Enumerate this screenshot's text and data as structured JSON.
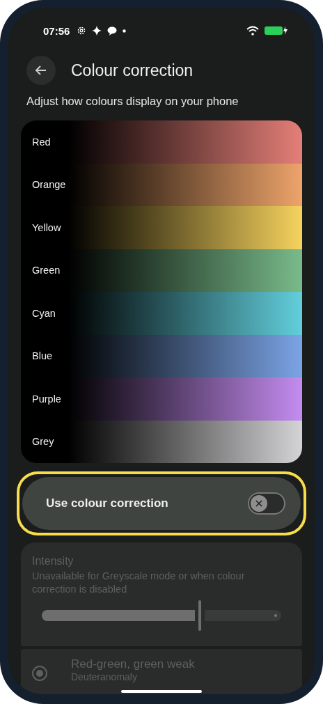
{
  "status_bar": {
    "time": "07:56",
    "charging": true
  },
  "header": {
    "title": "Colour correction"
  },
  "subtitle": "Adjust how colours display on your phone",
  "colour_bars": [
    {
      "label": "Red",
      "color": "#e57f78"
    },
    {
      "label": "Orange",
      "color": "#eea46b"
    },
    {
      "label": "Yellow",
      "color": "#f6d35e"
    },
    {
      "label": "Green",
      "color": "#79bb8a"
    },
    {
      "label": "Cyan",
      "color": "#62cfdc"
    },
    {
      "label": "Blue",
      "color": "#7ba4e6"
    },
    {
      "label": "Purple",
      "color": "#c48cf0"
    },
    {
      "label": "Grey",
      "color": "#d4d4d6"
    }
  ],
  "main_toggle": {
    "label": "Use colour correction",
    "on": false,
    "highlighted": true
  },
  "intensity": {
    "title": "Intensity",
    "description": "Unavailable for Greyscale mode or when colour correction is disabled",
    "level": 0.66,
    "disabled": true
  },
  "modes": [
    {
      "title": "Red-green, green weak",
      "subtitle": "Deuteranomaly",
      "selected": true,
      "disabled": true
    }
  ]
}
